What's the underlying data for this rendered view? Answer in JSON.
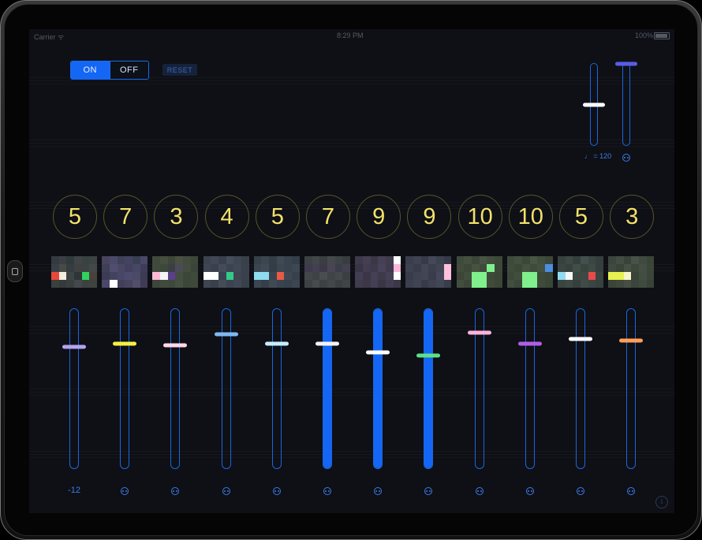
{
  "status_bar": {
    "carrier": "Carrier ᯤ",
    "time": "8:29 PM",
    "battery": "100%"
  },
  "toggle": {
    "on_label": "ON",
    "off_label": "OFF",
    "active": "on"
  },
  "reset_label": "RESET",
  "tempo": {
    "label": "♩ = 120",
    "level": 0.5,
    "knob_color": "#ffffff"
  },
  "master": {
    "level": 1.0,
    "knob_color": "#5a5de8"
  },
  "colors": {
    "accent": "#1466f5",
    "number_text": "#f3e16b"
  },
  "channels": [
    {
      "number": "5",
      "level": 0.76,
      "active": false,
      "knob_color": "#b6a2f0",
      "label": "-12",
      "grid": [
        "#343a40",
        "#3b3f44",
        "#2f3a3b",
        "#404446",
        "#39433e",
        "#3d4244",
        "#3a3f47",
        "#464b46",
        "#363c40",
        "#3f4240",
        "#3c4143",
        "#444747",
        "#e8483a",
        "#f3eede",
        "#3d4543",
        "#2f3438",
        "#2fd35b",
        "#48413c",
        "#3b3f3e",
        "#353b3c",
        "#3a3e40",
        "#45484b",
        "#3c4240",
        "#3e4340"
      ]
    },
    {
      "number": "7",
      "level": 0.78,
      "active": false,
      "knob_color": "#f6f045",
      "label": "",
      "grid": [
        "#48445e",
        "#4a4a68",
        "#3e415a",
        "#444461",
        "#3b3f52",
        "#4a4869",
        "#3f3f57",
        "#504e70",
        "#4a4665",
        "#443f5e",
        "#474665",
        "#3e3d58",
        "#3c3a55",
        "#434260",
        "#494768",
        "#4e4b6c",
        "#4a4968",
        "#3c3a55",
        "#4a4769",
        "#ffffff",
        "#423f5b",
        "#46445f",
        "#514d6b",
        "#3e3c57"
      ]
    },
    {
      "number": "3",
      "level": 0.77,
      "active": false,
      "knob_color": "#ffd9e8",
      "label": "",
      "grid": [
        "#3f4a3d",
        "#464e3f",
        "#3c4739",
        "#4a5141",
        "#424b3d",
        "#3d4838",
        "#414a3d",
        "#3c4839",
        "#3c3e45",
        "#4a4b57",
        "#434c3f",
        "#3b4438",
        "#ffb9d4",
        "#f3f5f7",
        "#5a3f8e",
        "#454d40",
        "#3c4639",
        "#404a3c",
        "#3c4639",
        "#414a3d",
        "#3f493b",
        "#465041",
        "#3c4739",
        "#3f483b"
      ]
    },
    {
      "number": "4",
      "level": 0.84,
      "active": false,
      "knob_color": "#7fb8f0",
      "label": "",
      "grid": [
        "#3c434f",
        "#414855",
        "#39404b",
        "#454c5a",
        "#3f4652",
        "#384049",
        "#3f4653",
        "#3a414c",
        "#454c58",
        "#3c4350",
        "#414855",
        "#3a414d",
        "#ffffff",
        "#ffffff",
        "#3c4350",
        "#33c98a",
        "#3f4652",
        "#3a414c",
        "#3f4652",
        "#3a414c",
        "#454c58",
        "#3c4350",
        "#414855",
        "#384049"
      ]
    },
    {
      "number": "5",
      "level": 0.78,
      "active": false,
      "knob_color": "#c8ecff",
      "label": "",
      "grid": [
        "#354049",
        "#3c4650",
        "#333e47",
        "#404a54",
        "#39434d",
        "#343e48",
        "#394550",
        "#3f4a55",
        "#323d46",
        "#3b4650",
        "#384350",
        "#3d4852",
        "#8fdbf0",
        "#8fdbf0",
        "#3a444f",
        "#e85a44",
        "#3e4853",
        "#37414b",
        "#3c4650",
        "#353f49",
        "#404a54",
        "#3a444e",
        "#37414b",
        "#3c4650"
      ]
    },
    {
      "number": "7",
      "level": 1.0,
      "fill": 0.78,
      "active": true,
      "knob_color": "#f4f4f4",
      "label": "",
      "grid": [
        "#3c4244",
        "#42484a",
        "#393f41",
        "#46494b",
        "#3e4446",
        "#383e40",
        "#3f3a4e",
        "#454050",
        "#3d3848",
        "#4a4556",
        "#3c3d4a",
        "#434052",
        "#43474a",
        "#3d4244",
        "#494d50",
        "#3f4446",
        "#444a4c",
        "#3a4042",
        "#3d4244",
        "#464b4e",
        "#3c4143",
        "#42474a",
        "#3a3f41",
        "#3f4447"
      ]
    },
    {
      "number": "9",
      "level": 1.0,
      "fill": 0.73,
      "active": true,
      "knob_color": "#ffffff",
      "label": "",
      "grid": [
        "#3e3a4a",
        "#453f52",
        "#3b3747",
        "#473f55",
        "#413b4e",
        "#ffffff",
        "#393546",
        "#423c4f",
        "#3e394b",
        "#48435a",
        "#3f3a4d",
        "#ffb5d9",
        "#433e52",
        "#3b3647",
        "#463f55",
        "#3e394b",
        "#454053",
        "#ffffff",
        "#403b4d",
        "#3d3849",
        "#443f52",
        "#3a3646",
        "#423d50",
        "#3c3849"
      ]
    },
    {
      "number": "9",
      "level": 1.0,
      "fill": 0.71,
      "active": true,
      "knob_color": "#5ce08a",
      "label": "",
      "grid": [
        "#3a3d4c",
        "#404352",
        "#373a49",
        "#454858",
        "#3d404f",
        "#363948",
        "#3e4150",
        "#393c4b",
        "#434656",
        "#3b3e4d",
        "#414453",
        "#ffc1dd",
        "#383b4a",
        "#3f4251",
        "#424555",
        "#393c4b",
        "#45485a",
        "#ffc1dd",
        "#3c3f4e",
        "#414453",
        "#373a49",
        "#3e4150",
        "#434656",
        "#393c4b"
      ]
    },
    {
      "number": "10",
      "level": 0.85,
      "active": false,
      "knob_color": "#ffb3da",
      "label": "",
      "grid": [
        "#3e4a3a",
        "#45503f",
        "#3b4737",
        "#4a5443",
        "#424d3e",
        "#3c4838",
        "#414c3c",
        "#3c4737",
        "#47523f",
        "#3f4a3a",
        "#7ff08c",
        "#3d4839",
        "#3b4637",
        "#424d3d",
        "#7ff08c",
        "#7ff08c",
        "#3e4939",
        "#3a4536",
        "#434e3e",
        "#3c4738",
        "#7ff08c",
        "#7ff08c",
        "#404b3b",
        "#3b4637"
      ]
    },
    {
      "number": "10",
      "level": 0.78,
      "active": false,
      "knob_color": "#b25de8",
      "label": "",
      "grid": [
        "#3d4a3c",
        "#44503f",
        "#3a4739",
        "#4a5544",
        "#414d3d",
        "#3b4838",
        "#404c3b",
        "#3b4737",
        "#46523f",
        "#3e4a3a",
        "#45513f",
        "#4a8fe0",
        "#3c4838",
        "#414d3d",
        "#7ff08c",
        "#7ff08c",
        "#3d4939",
        "#3a4636",
        "#424e3e",
        "#3b4737",
        "#7ff08c",
        "#7ff08c",
        "#3f4b3b",
        "#3a4636"
      ]
    },
    {
      "number": "5",
      "level": 0.81,
      "active": false,
      "knob_color": "#ffffff",
      "label": "",
      "grid": [
        "#37423f",
        "#3e4946",
        "#35403d",
        "#43504c",
        "#3b4643",
        "#34403d",
        "#3a4542",
        "#36413e",
        "#414d49",
        "#39443f",
        "#3f4a47",
        "#35403d",
        "#8fdbf0",
        "#f6f6f6",
        "#3d4845",
        "#3e4946",
        "#e84a4a",
        "#3a4542",
        "#3a4542",
        "#3e4946",
        "#35403d",
        "#404b48",
        "#3b4643",
        "#37423f"
      ]
    },
    {
      "number": "3",
      "level": 0.8,
      "active": false,
      "knob_color": "#ff9f5a",
      "label": "",
      "grid": [
        "#3c453d",
        "#434d43",
        "#3a4339",
        "#485247",
        "#404a40",
        "#3b4439",
        "#3f493f",
        "#3a4338",
        "#465045",
        "#3e473c",
        "#444e43",
        "#3c453a",
        "#e7f050",
        "#e7f050",
        "#f7f4c9",
        "#3a4339",
        "#434d42",
        "#3c4539",
        "#3b4438",
        "#3f483d",
        "#464f44",
        "#3c4539",
        "#414a3f",
        "#394237"
      ]
    }
  ]
}
